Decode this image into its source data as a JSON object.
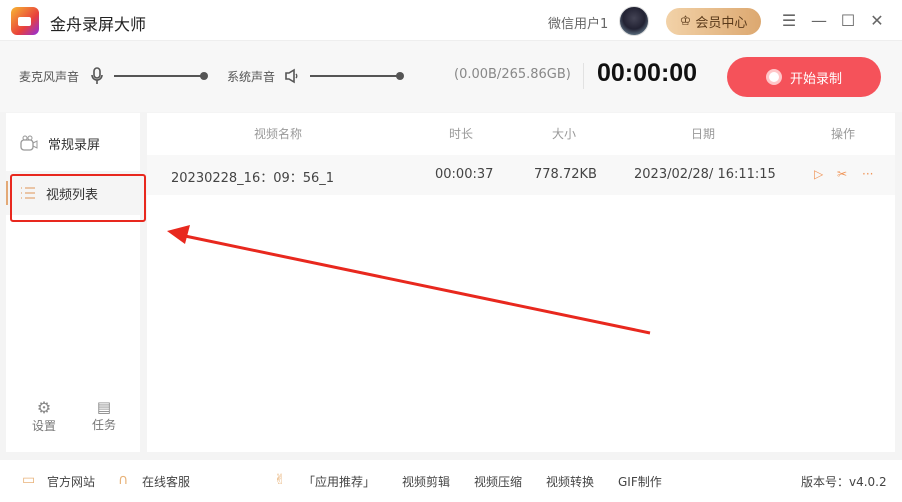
{
  "app": {
    "title": "金舟录屏大师",
    "user": "微信用户1",
    "vip_label": "会员中心"
  },
  "window": {
    "menu": "☰",
    "minimize": "—",
    "maximize": "☐",
    "close": "✕"
  },
  "toolbar": {
    "mic_label": "麦克风声音",
    "mic_level": 1.0,
    "system_label": "系统声音",
    "system_level": 1.0,
    "storage": "(0.00B/265.86GB)",
    "timer": "00:00:00",
    "record_label": "开始录制"
  },
  "sidebar": {
    "items": [
      {
        "label": "常规录屏"
      },
      {
        "label": "视频列表",
        "active": true
      }
    ],
    "settings": "设置",
    "tasks": "任务"
  },
  "table": {
    "headers": [
      "视频名称",
      "时长",
      "大小",
      "日期",
      "操作"
    ],
    "rows": [
      {
        "name": "20230228_16：09：56_1",
        "duration": "00:00:37",
        "size": "778.72KB",
        "date": "2023/02/28/ 16:11:15"
      }
    ],
    "actions": {
      "play": "▷",
      "cut": "✂",
      "more": "···"
    }
  },
  "footer": {
    "website": "官方网站",
    "support": "在线客服",
    "recommend": "「应用推荐」",
    "links": [
      "视频剪辑",
      "视频压缩",
      "视频转换",
      "GIF制作"
    ],
    "version": "版本号：v4.0.2"
  },
  "colors": {
    "accent": "#f5525a",
    "annotation": "#e8281e",
    "gold": "#e3a977"
  }
}
